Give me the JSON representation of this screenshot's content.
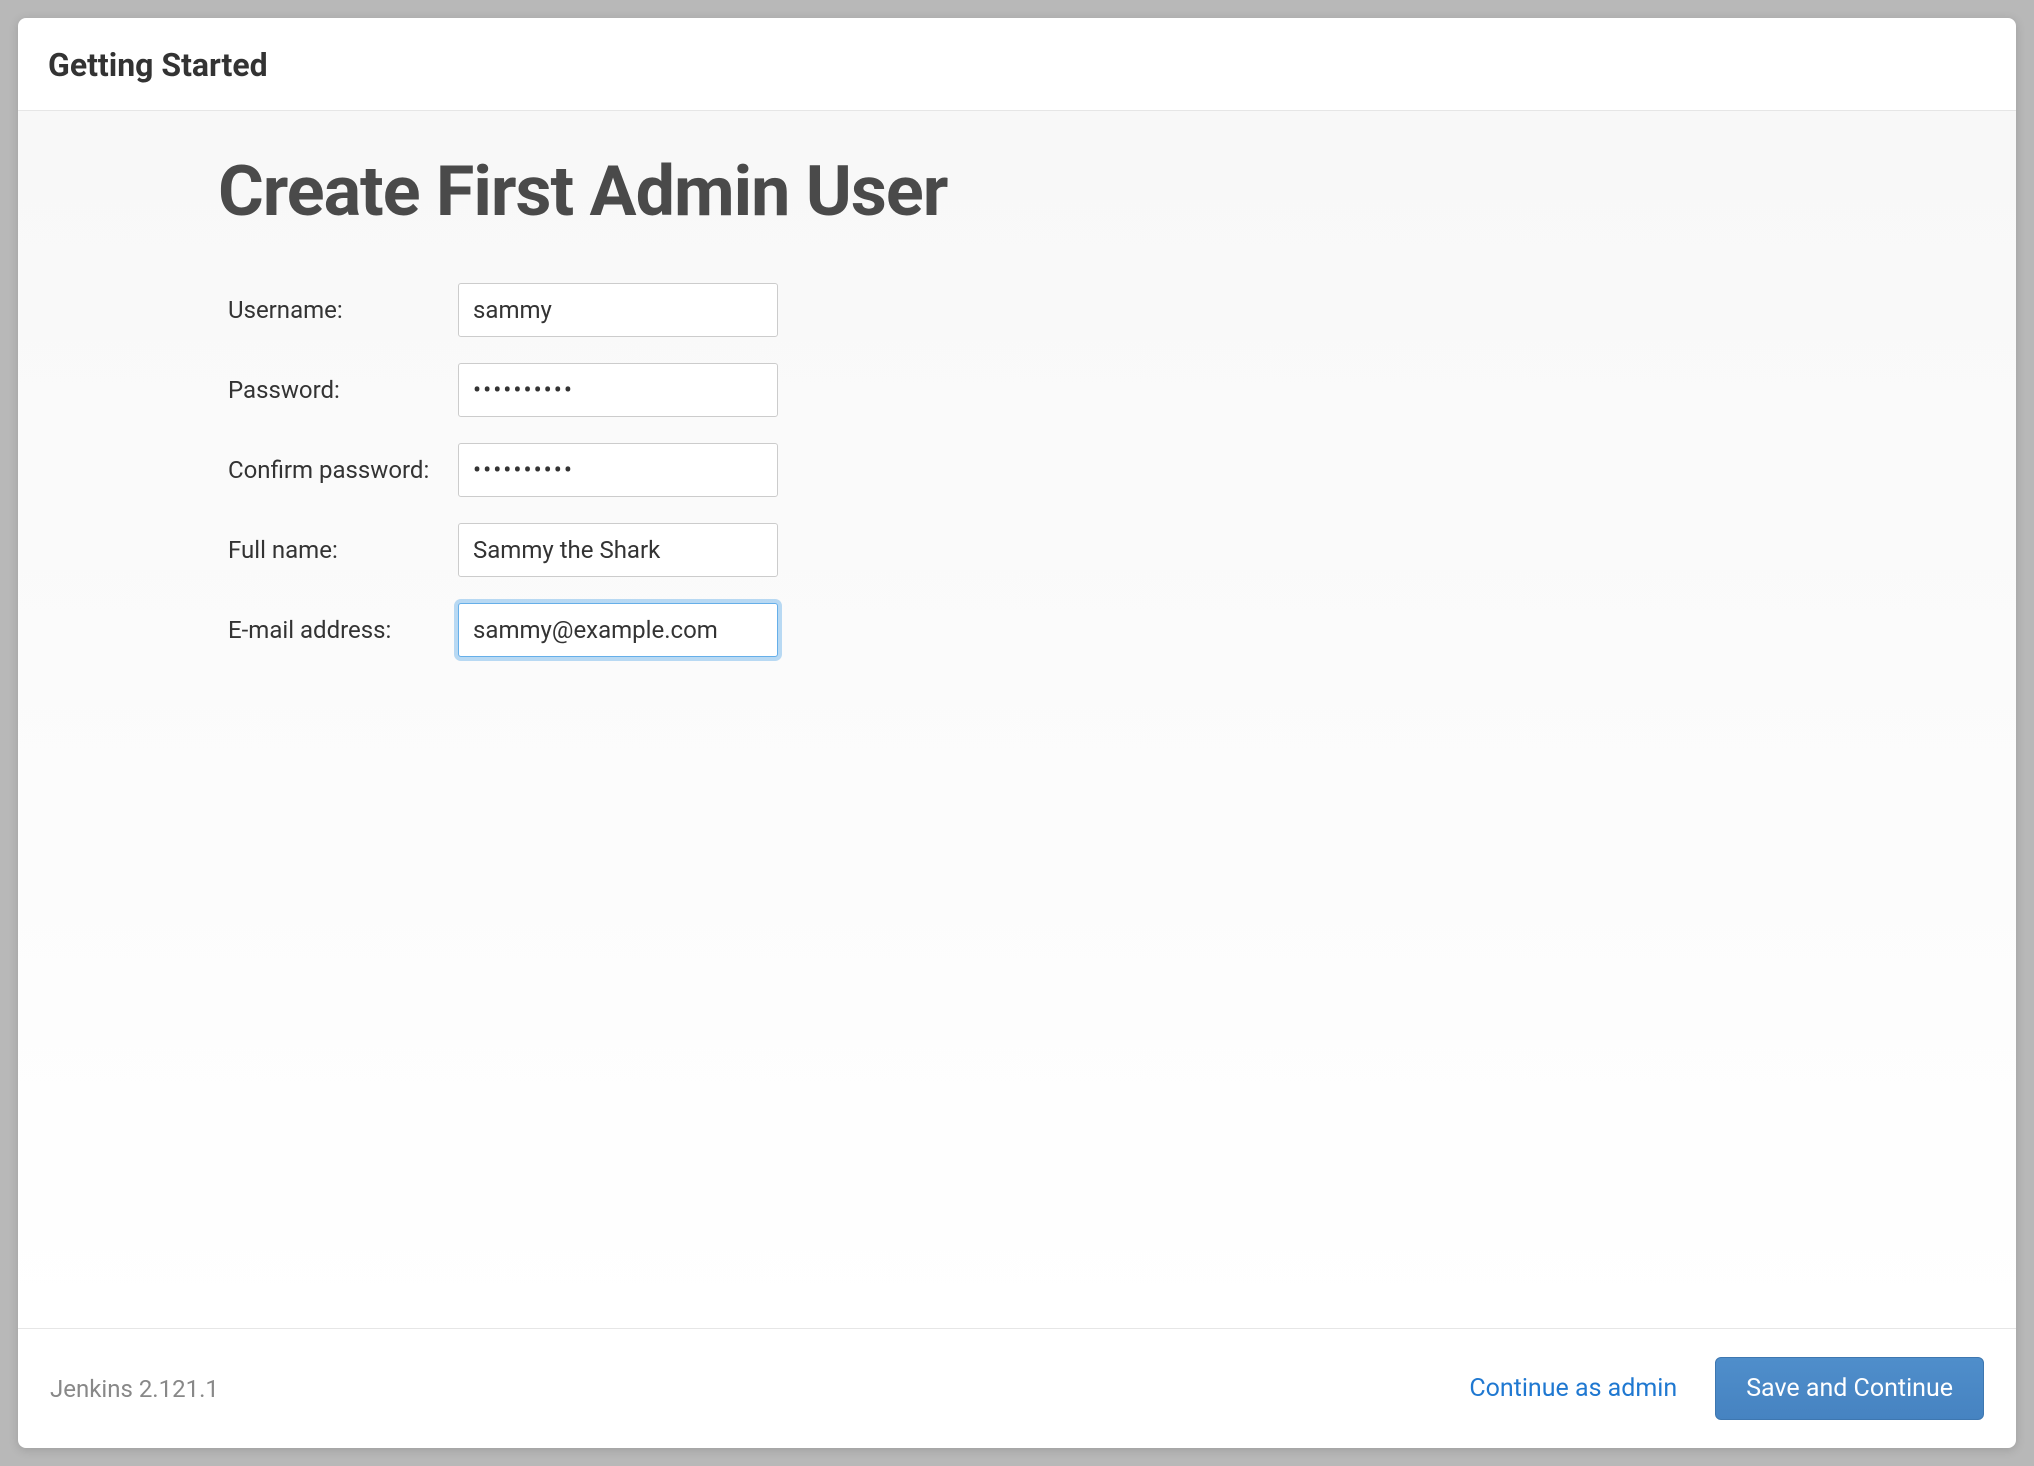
{
  "header": {
    "title": "Getting Started"
  },
  "main": {
    "page_title": "Create First Admin User",
    "form": {
      "username": {
        "label": "Username:",
        "value": "sammy"
      },
      "password": {
        "label": "Password:",
        "value": "••••••••••"
      },
      "confirm_password": {
        "label": "Confirm password:",
        "value": "••••••••••"
      },
      "fullname": {
        "label": "Full name:",
        "value": "Sammy the Shark"
      },
      "email": {
        "label": "E-mail address:",
        "value": "sammy@example.com"
      }
    }
  },
  "footer": {
    "version": "Jenkins 2.121.1",
    "continue_as_admin": "Continue as admin",
    "save_and_continue": "Save and Continue"
  }
}
